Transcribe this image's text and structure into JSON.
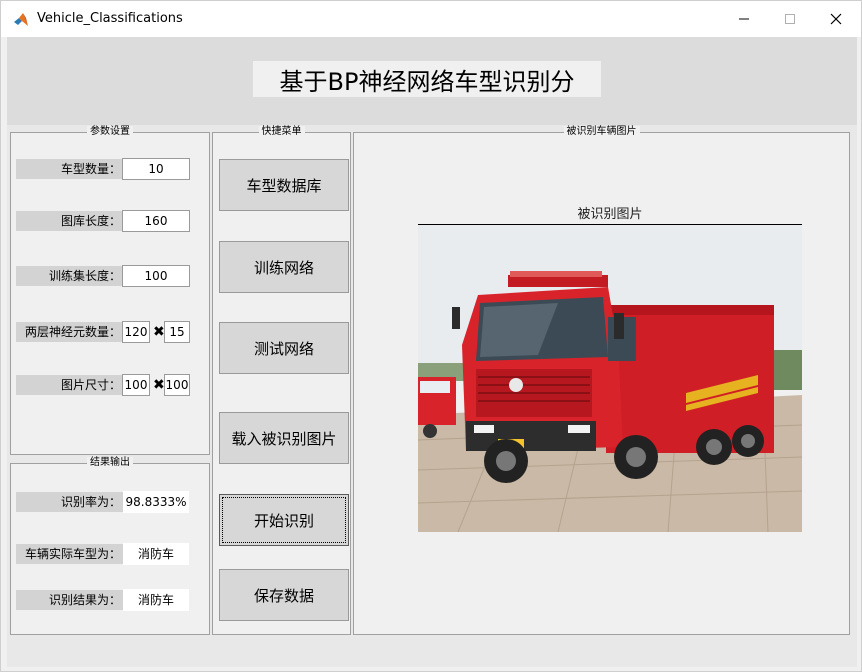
{
  "window": {
    "title": "Vehicle_Classifications",
    "icon": "matlab-logo-icon",
    "controls": [
      "minimize-icon",
      "maximize-icon",
      "close-icon"
    ]
  },
  "header": {
    "title": "基于BP神经网络车型识别分"
  },
  "params": {
    "title": "参数设置",
    "class_count": {
      "label": "车型数量：",
      "value": "10"
    },
    "library_length": {
      "label": "图库长度：",
      "value": "160"
    },
    "train_length": {
      "label": "训练集长度：",
      "value": "100"
    },
    "neurons": {
      "label": "两层神经元数量：",
      "value1": "120",
      "value2": "15"
    },
    "image_size": {
      "label": "图片尺寸：",
      "value1": "100",
      "value2": "100"
    }
  },
  "results": {
    "title": "结果输出",
    "accuracy": {
      "label": "识别率为：",
      "value": "98.8333%"
    },
    "actual_type": {
      "label": "车辆实际车型为：",
      "value": "消防车"
    },
    "result": {
      "label": "识别结果为：",
      "value": "消防车"
    }
  },
  "menu": {
    "title": "快捷菜单",
    "buttons": {
      "database": "车型数据库",
      "train": "训练网络",
      "test": "测试网络",
      "load": "载入被识别图片",
      "start": "开始识别",
      "save": "保存数据"
    }
  },
  "image_panel": {
    "title": "被识别车辆图片",
    "axes_title": "被识别图片"
  },
  "colors": {
    "window_bg": "#f0f0f0",
    "label_bg": "#d3d3d3",
    "button_bg": "#d7d7d7",
    "truck_red": "#d8232a"
  }
}
